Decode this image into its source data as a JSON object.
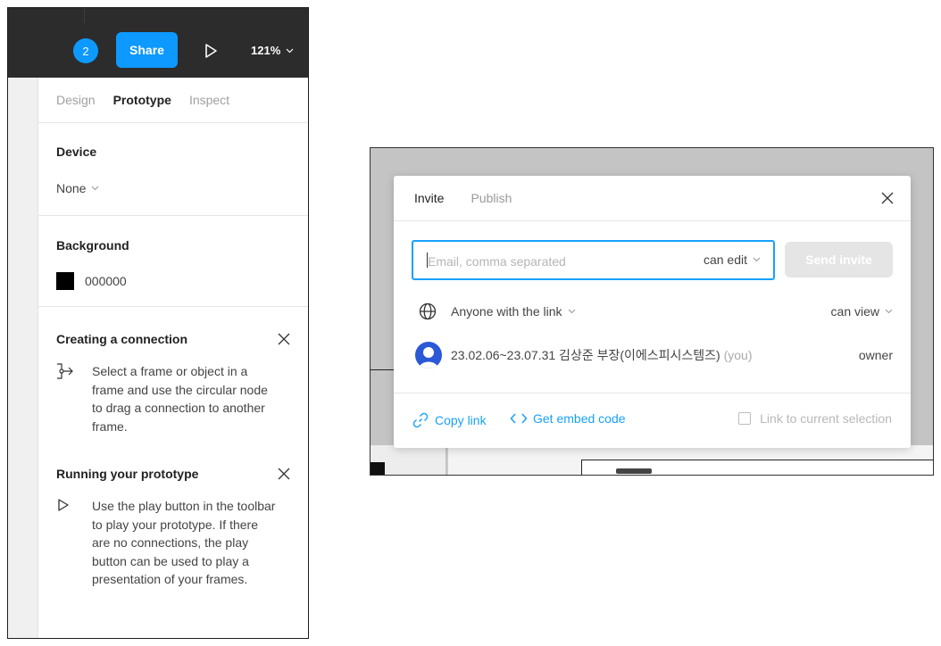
{
  "toolbar": {
    "collaborator_count": "2",
    "share_label": "Share",
    "zoom_label": "121%"
  },
  "sidebar": {
    "tabs": [
      {
        "label": "Design",
        "active": false
      },
      {
        "label": "Prototype",
        "active": true
      },
      {
        "label": "Inspect",
        "active": false
      }
    ],
    "device": {
      "title": "Device",
      "value": "None"
    },
    "background": {
      "title": "Background",
      "color_hex": "000000",
      "swatch": "#000000"
    },
    "help": [
      {
        "title": "Creating a connection",
        "lines": [
          "Select a frame or object in a",
          "frame and use the circular node",
          "to drag a connection to another",
          "frame."
        ]
      },
      {
        "title": "Running your prototype",
        "lines": [
          "Use the play button in the toolbar",
          "to play your prototype. If there",
          "are no connections, the play",
          "button can be used to play a",
          "presentation of your frames."
        ]
      }
    ]
  },
  "dialog": {
    "tabs": [
      {
        "label": "Invite",
        "active": true
      },
      {
        "label": "Publish",
        "active": false
      }
    ],
    "email_placeholder": "Email, comma separated",
    "email_permission": "can edit",
    "send_label": "Send invite",
    "link_access": {
      "label": "Anyone with the link",
      "permission": "can view"
    },
    "member": {
      "name": "23.02.06~23.07.31 김상준 부장(이에스피시스템즈)",
      "you_label": "(you)",
      "role": "owner"
    },
    "footer": {
      "copy_link": "Copy link",
      "embed": "Get embed code",
      "link_selection": "Link to current selection"
    }
  },
  "colors": {
    "accent": "#18a0fb",
    "toolbar_bg": "#2c2c2c",
    "avatar": "#2a58d6"
  }
}
